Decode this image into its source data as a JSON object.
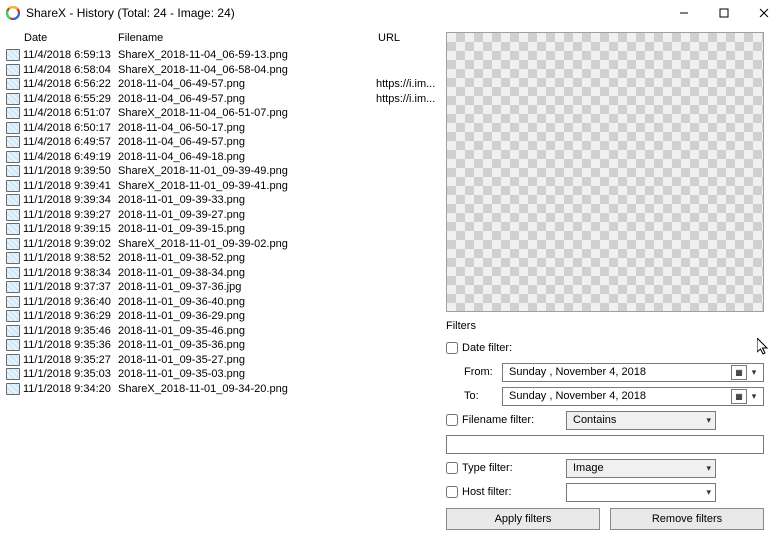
{
  "window": {
    "title": "ShareX - History (Total: 24 - Image: 24)"
  },
  "columns": {
    "date": "Date",
    "filename": "Filename",
    "url": "URL"
  },
  "rows": [
    {
      "date": "11/4/2018 6:59:13",
      "file": "ShareX_2018-11-04_06-59-13.png",
      "url": ""
    },
    {
      "date": "11/4/2018 6:58:04",
      "file": "ShareX_2018-11-04_06-58-04.png",
      "url": ""
    },
    {
      "date": "11/4/2018 6:56:22",
      "file": "2018-11-04_06-49-57.png",
      "url": "https://i.im..."
    },
    {
      "date": "11/4/2018 6:55:29",
      "file": "2018-11-04_06-49-57.png",
      "url": "https://i.im..."
    },
    {
      "date": "11/4/2018 6:51:07",
      "file": "ShareX_2018-11-04_06-51-07.png",
      "url": ""
    },
    {
      "date": "11/4/2018 6:50:17",
      "file": "2018-11-04_06-50-17.png",
      "url": ""
    },
    {
      "date": "11/4/2018 6:49:57",
      "file": "2018-11-04_06-49-57.png",
      "url": ""
    },
    {
      "date": "11/4/2018 6:49:19",
      "file": "2018-11-04_06-49-18.png",
      "url": ""
    },
    {
      "date": "11/1/2018 9:39:50",
      "file": "ShareX_2018-11-01_09-39-49.png",
      "url": ""
    },
    {
      "date": "11/1/2018 9:39:41",
      "file": "ShareX_2018-11-01_09-39-41.png",
      "url": ""
    },
    {
      "date": "11/1/2018 9:39:34",
      "file": "2018-11-01_09-39-33.png",
      "url": ""
    },
    {
      "date": "11/1/2018 9:39:27",
      "file": "2018-11-01_09-39-27.png",
      "url": ""
    },
    {
      "date": "11/1/2018 9:39:15",
      "file": "2018-11-01_09-39-15.png",
      "url": ""
    },
    {
      "date": "11/1/2018 9:39:02",
      "file": "ShareX_2018-11-01_09-39-02.png",
      "url": ""
    },
    {
      "date": "11/1/2018 9:38:52",
      "file": "2018-11-01_09-38-52.png",
      "url": ""
    },
    {
      "date": "11/1/2018 9:38:34",
      "file": "2018-11-01_09-38-34.png",
      "url": ""
    },
    {
      "date": "11/1/2018 9:37:37",
      "file": "2018-11-01_09-37-36.jpg",
      "url": ""
    },
    {
      "date": "11/1/2018 9:36:40",
      "file": "2018-11-01_09-36-40.png",
      "url": ""
    },
    {
      "date": "11/1/2018 9:36:29",
      "file": "2018-11-01_09-36-29.png",
      "url": ""
    },
    {
      "date": "11/1/2018 9:35:46",
      "file": "2018-11-01_09-35-46.png",
      "url": ""
    },
    {
      "date": "11/1/2018 9:35:36",
      "file": "2018-11-01_09-35-36.png",
      "url": ""
    },
    {
      "date": "11/1/2018 9:35:27",
      "file": "2018-11-01_09-35-27.png",
      "url": ""
    },
    {
      "date": "11/1/2018 9:35:03",
      "file": "2018-11-01_09-35-03.png",
      "url": ""
    },
    {
      "date": "11/1/2018 9:34:20",
      "file": "ShareX_2018-11-01_09-34-20.png",
      "url": ""
    }
  ],
  "filters": {
    "heading": "Filters",
    "date_label": "Date filter:",
    "from_label": "From:",
    "to_label": "To:",
    "from_value": "Sunday   , November   4, 2018",
    "to_value": "Sunday   , November   4, 2018",
    "filename_label": "Filename filter:",
    "filename_mode": "Contains",
    "filename_value": "",
    "type_label": "Type filter:",
    "type_value": "Image",
    "host_label": "Host filter:",
    "host_value": "",
    "apply": "Apply filters",
    "remove": "Remove filters"
  }
}
